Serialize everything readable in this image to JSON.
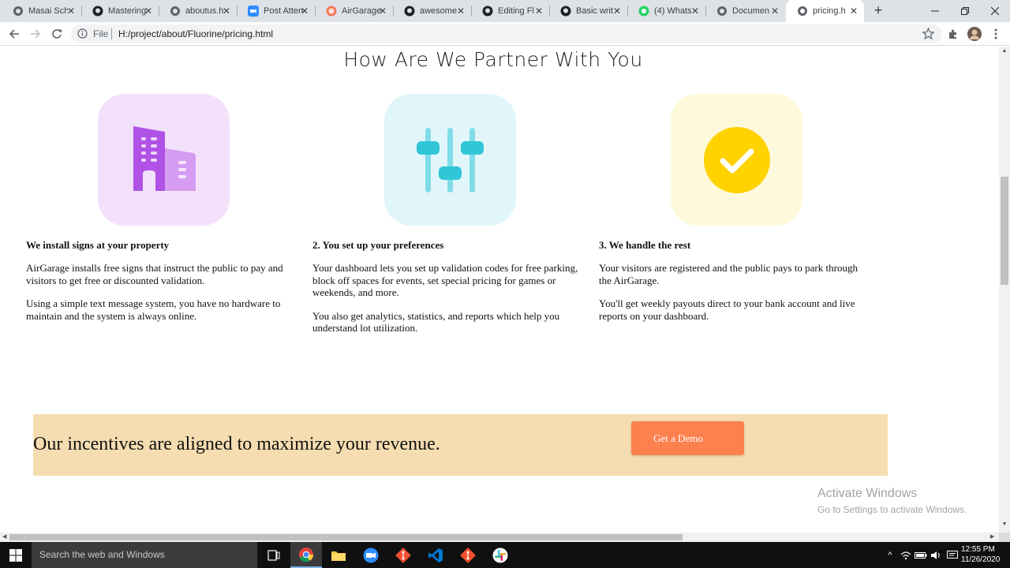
{
  "browser": {
    "tabs": [
      {
        "title": "Masai Sch",
        "icon": "globe-icon",
        "active": false
      },
      {
        "title": "Mastering",
        "icon": "github-icon",
        "active": false
      },
      {
        "title": "aboutus.h",
        "icon": "globe-icon",
        "active": false
      },
      {
        "title": "Post Atten",
        "icon": "zoom-icon",
        "active": false
      },
      {
        "title": "AirGarage",
        "icon": "airgarage-icon",
        "active": false
      },
      {
        "title": "awesome",
        "icon": "github-icon",
        "active": false
      },
      {
        "title": "Editing Fl",
        "icon": "github-icon",
        "active": false
      },
      {
        "title": "Basic writ",
        "icon": "github-icon",
        "active": false
      },
      {
        "title": "(4) Whats",
        "icon": "whatsapp-icon",
        "active": false
      },
      {
        "title": "Documen",
        "icon": "globe-icon",
        "active": false
      },
      {
        "title": "pricing.ht",
        "icon": "globe-icon",
        "active": true
      }
    ],
    "address": {
      "scheme_label": "File",
      "url": "H:/project/about/Fluorine/pricing.html"
    }
  },
  "page": {
    "title": "How Are We Partner With You",
    "columns": [
      {
        "icon": "building-icon",
        "heading": "We install signs at your property",
        "paragraphs": [
          "AirGarage installs free signs that instruct the public to pay and visitors to get free or discounted validation.",
          "Using a simple text message system, you have no hardware to maintain and the system is always online."
        ]
      },
      {
        "icon": "sliders-icon",
        "heading": "2. You set up your preferences",
        "paragraphs": [
          "Your dashboard lets you set up validation codes for free parking, block off spaces for events, set special pricing for games or weekends, and more.",
          "You also get analytics, statistics, and reports which help you understand lot utilization."
        ]
      },
      {
        "icon": "checkmark-circle-icon",
        "heading": "3. We handle the rest",
        "paragraphs": [
          "Your visitors are registered and the public pays to park through the AirGarage.",
          "You'll get weekly payouts direct to your bank account and live reports on your dashboard."
        ]
      }
    ],
    "banner": {
      "text": "Our incentives are aligned to maximize your revenue.",
      "button_label": "Get a Demo"
    }
  },
  "watermark": {
    "line1": "Activate Windows",
    "line2": "Go to Settings to activate Windows."
  },
  "taskbar": {
    "search_placeholder": "Search the web and Windows",
    "apps": [
      "task-view-icon",
      "chrome-icon",
      "file-explorer-icon",
      "zoom-icon",
      "git-icon",
      "vscode-icon",
      "git-icon",
      "slack-icon"
    ],
    "clock": {
      "time": "12:55 PM",
      "date": "11/26/2020"
    }
  },
  "colors": {
    "tabstrip": "#dee1e6",
    "card_purple_bg": "#f3e1fb",
    "card_cyan_bg": "#e1f6fa",
    "card_yellow_bg": "#fff9db",
    "building_purple": "#b052e6",
    "slider_cyan": "#30c6d8",
    "check_yellow": "#ffd200",
    "banner_bg": "#f5ddb1",
    "button_orange": "#fc814f"
  }
}
